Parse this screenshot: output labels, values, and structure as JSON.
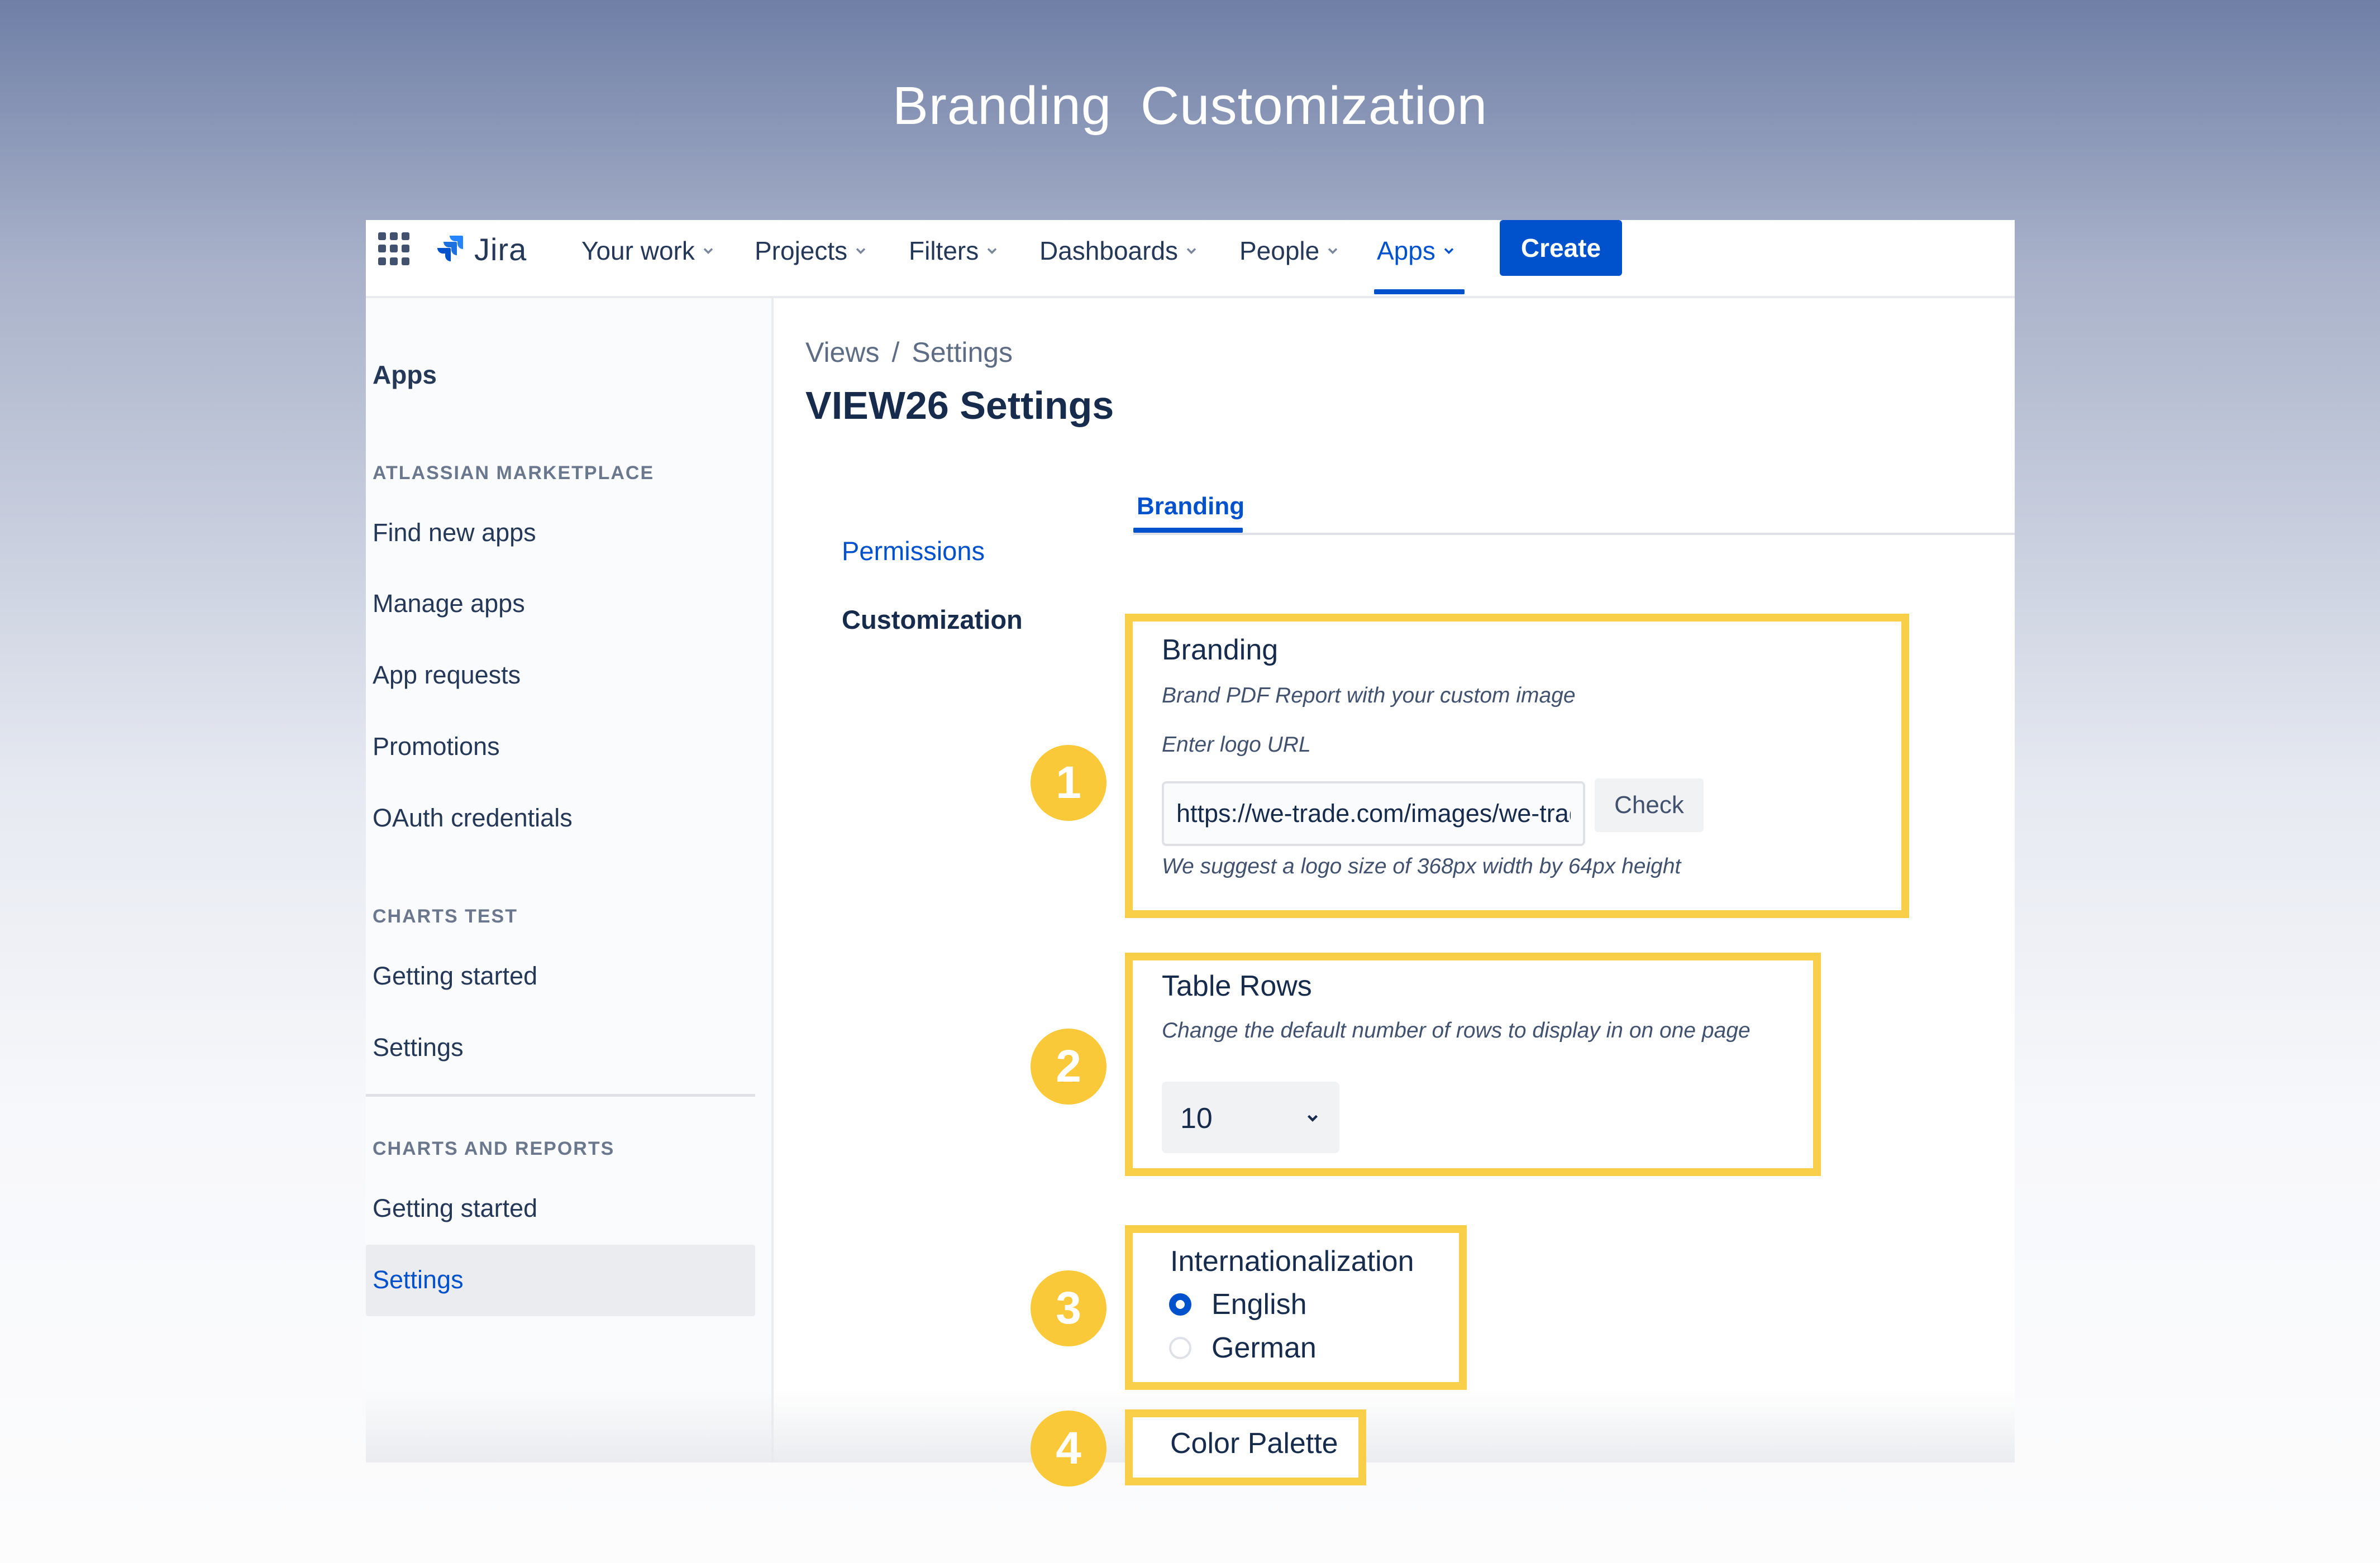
{
  "hero": {
    "title": "Branding  Customization"
  },
  "nav": {
    "brand": "Jira",
    "items": [
      {
        "label": "Your work"
      },
      {
        "label": "Projects"
      },
      {
        "label": "Filters"
      },
      {
        "label": "Dashboards"
      },
      {
        "label": "People"
      },
      {
        "label": "Apps"
      }
    ],
    "active": "Apps",
    "create_label": "Create",
    "icons": {
      "app_switcher": "grid-icon",
      "brand": "jira-logo-icon",
      "dropdown": "chevron-down-icon"
    }
  },
  "sidebar": {
    "title": "Apps",
    "groups": [
      {
        "heading": "ATLASSIAN MARKETPLACE",
        "items": [
          "Find new apps",
          "Manage apps",
          "App requests",
          "Promotions",
          "OAuth credentials"
        ]
      },
      {
        "heading": "CHARTS TEST",
        "items": [
          "Getting started",
          "Settings"
        ]
      },
      {
        "heading": "CHARTS AND REPORTS",
        "items": [
          "Getting started",
          "Settings"
        ]
      }
    ],
    "selected": "Settings"
  },
  "main": {
    "breadcrumb": [
      "Views",
      "Settings"
    ],
    "title": "VIEW26 Settings",
    "left_nav": [
      "Permissions",
      "Customization"
    ],
    "tab": "Branding",
    "branding": {
      "title": "Branding",
      "description": "Brand PDF Report with your custom image",
      "input_label": "Enter logo URL",
      "logo_url": "https://we-trade.com/images/we-trade.svg",
      "check_label": "Check",
      "hint": "We suggest a logo size of 368px width by 64px height"
    },
    "table_rows": {
      "title": "Table Rows",
      "description": "Change the default number of rows to display in on one page",
      "value": "10"
    },
    "internationalization": {
      "title": "Internationalization",
      "options": [
        {
          "label": "English",
          "selected": true
        },
        {
          "label": "German",
          "selected": false
        }
      ]
    },
    "color_palette": {
      "title": "Color Palette"
    }
  },
  "badges": [
    "1",
    "2",
    "3",
    "4"
  ],
  "colors": {
    "accent": "#0052cc",
    "highlight": "#f9cf4a",
    "badge": "#f9c93a",
    "text": "#172b4d"
  }
}
